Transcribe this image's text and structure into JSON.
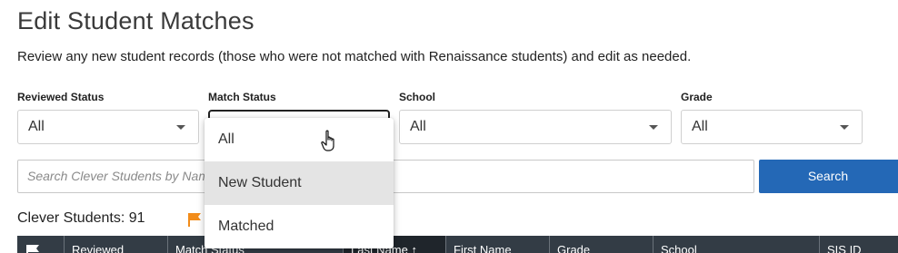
{
  "page": {
    "title": "Edit Student Matches",
    "description": "Review any new student records (those who were not matched with Renaissance students) and edit as needed."
  },
  "filters": {
    "reviewed_status": {
      "label": "Reviewed Status",
      "value": "All"
    },
    "match_status": {
      "label": "Match Status",
      "value": "",
      "options": [
        "All",
        "New Student",
        "Matched"
      ],
      "hovered_option": "New Student"
    },
    "school": {
      "label": "School",
      "value": "All"
    },
    "grade": {
      "label": "Grade",
      "value": "All"
    }
  },
  "search": {
    "placeholder": "Search Clever Students by Name",
    "button_label": "Search"
  },
  "results": {
    "count_label": "Clever Students: 91",
    "flag_color": "#f28c1a"
  },
  "table": {
    "columns": [
      "Reviewed",
      "Match Status",
      "Last Name ↑",
      "First Name",
      "Grade",
      "School",
      "SIS ID"
    ],
    "sorted_column": "Last Name"
  },
  "colors": {
    "accent": "#2468b6",
    "header_bg": "#333c45"
  }
}
